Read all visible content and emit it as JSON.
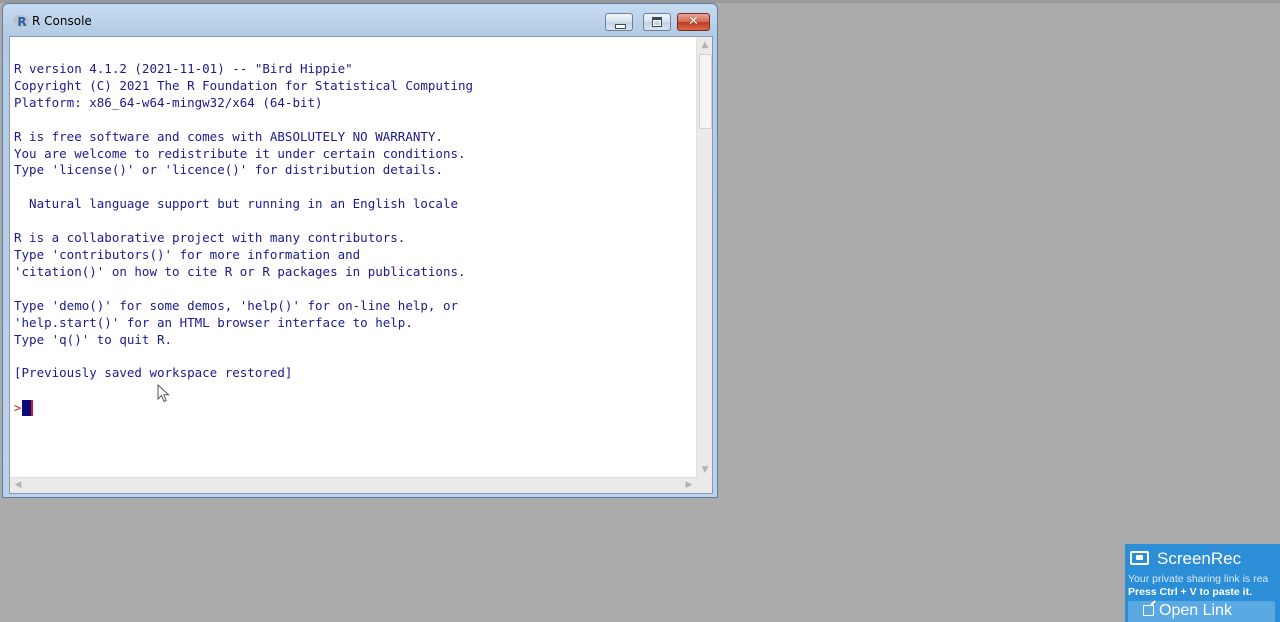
{
  "window": {
    "title": "R Console",
    "app_icon_letter": "R",
    "close_glyph": "✕"
  },
  "console": {
    "output": "R version 4.1.2 (2021-11-01) -- \"Bird Hippie\"\nCopyright (C) 2021 The R Foundation for Statistical Computing\nPlatform: x86_64-w64-mingw32/x64 (64-bit)\n\nR is free software and comes with ABSOLUTELY NO WARRANTY.\nYou are welcome to redistribute it under certain conditions.\nType 'license()' or 'licence()' for distribution details.\n\n  Natural language support but running in an English locale\n\nR is a collaborative project with many contributors.\nType 'contributors()' for more information and\n'citation()' on how to cite R or R packages in publications.\n\nType 'demo()' for some demos, 'help()' for on-line help, or\n'help.start()' for an HTML browser interface to help.\nType 'q()' to quit R.\n\n[Previously saved workspace restored]",
    "prompt": ">",
    "text_color": "#1b1b8f",
    "prompt_color": "#d11a1a"
  },
  "scrollbars": {
    "up": "▲",
    "down": "▼",
    "left": "◀",
    "right": "▶"
  },
  "screenrec": {
    "brand": "ScreenRec",
    "line1": "Your private sharing link is rea",
    "line2": "Press Ctrl + V to paste it.",
    "button_label": "Open Link",
    "background": "#2b8ed6"
  },
  "desktop": {
    "background": "#ababab"
  }
}
